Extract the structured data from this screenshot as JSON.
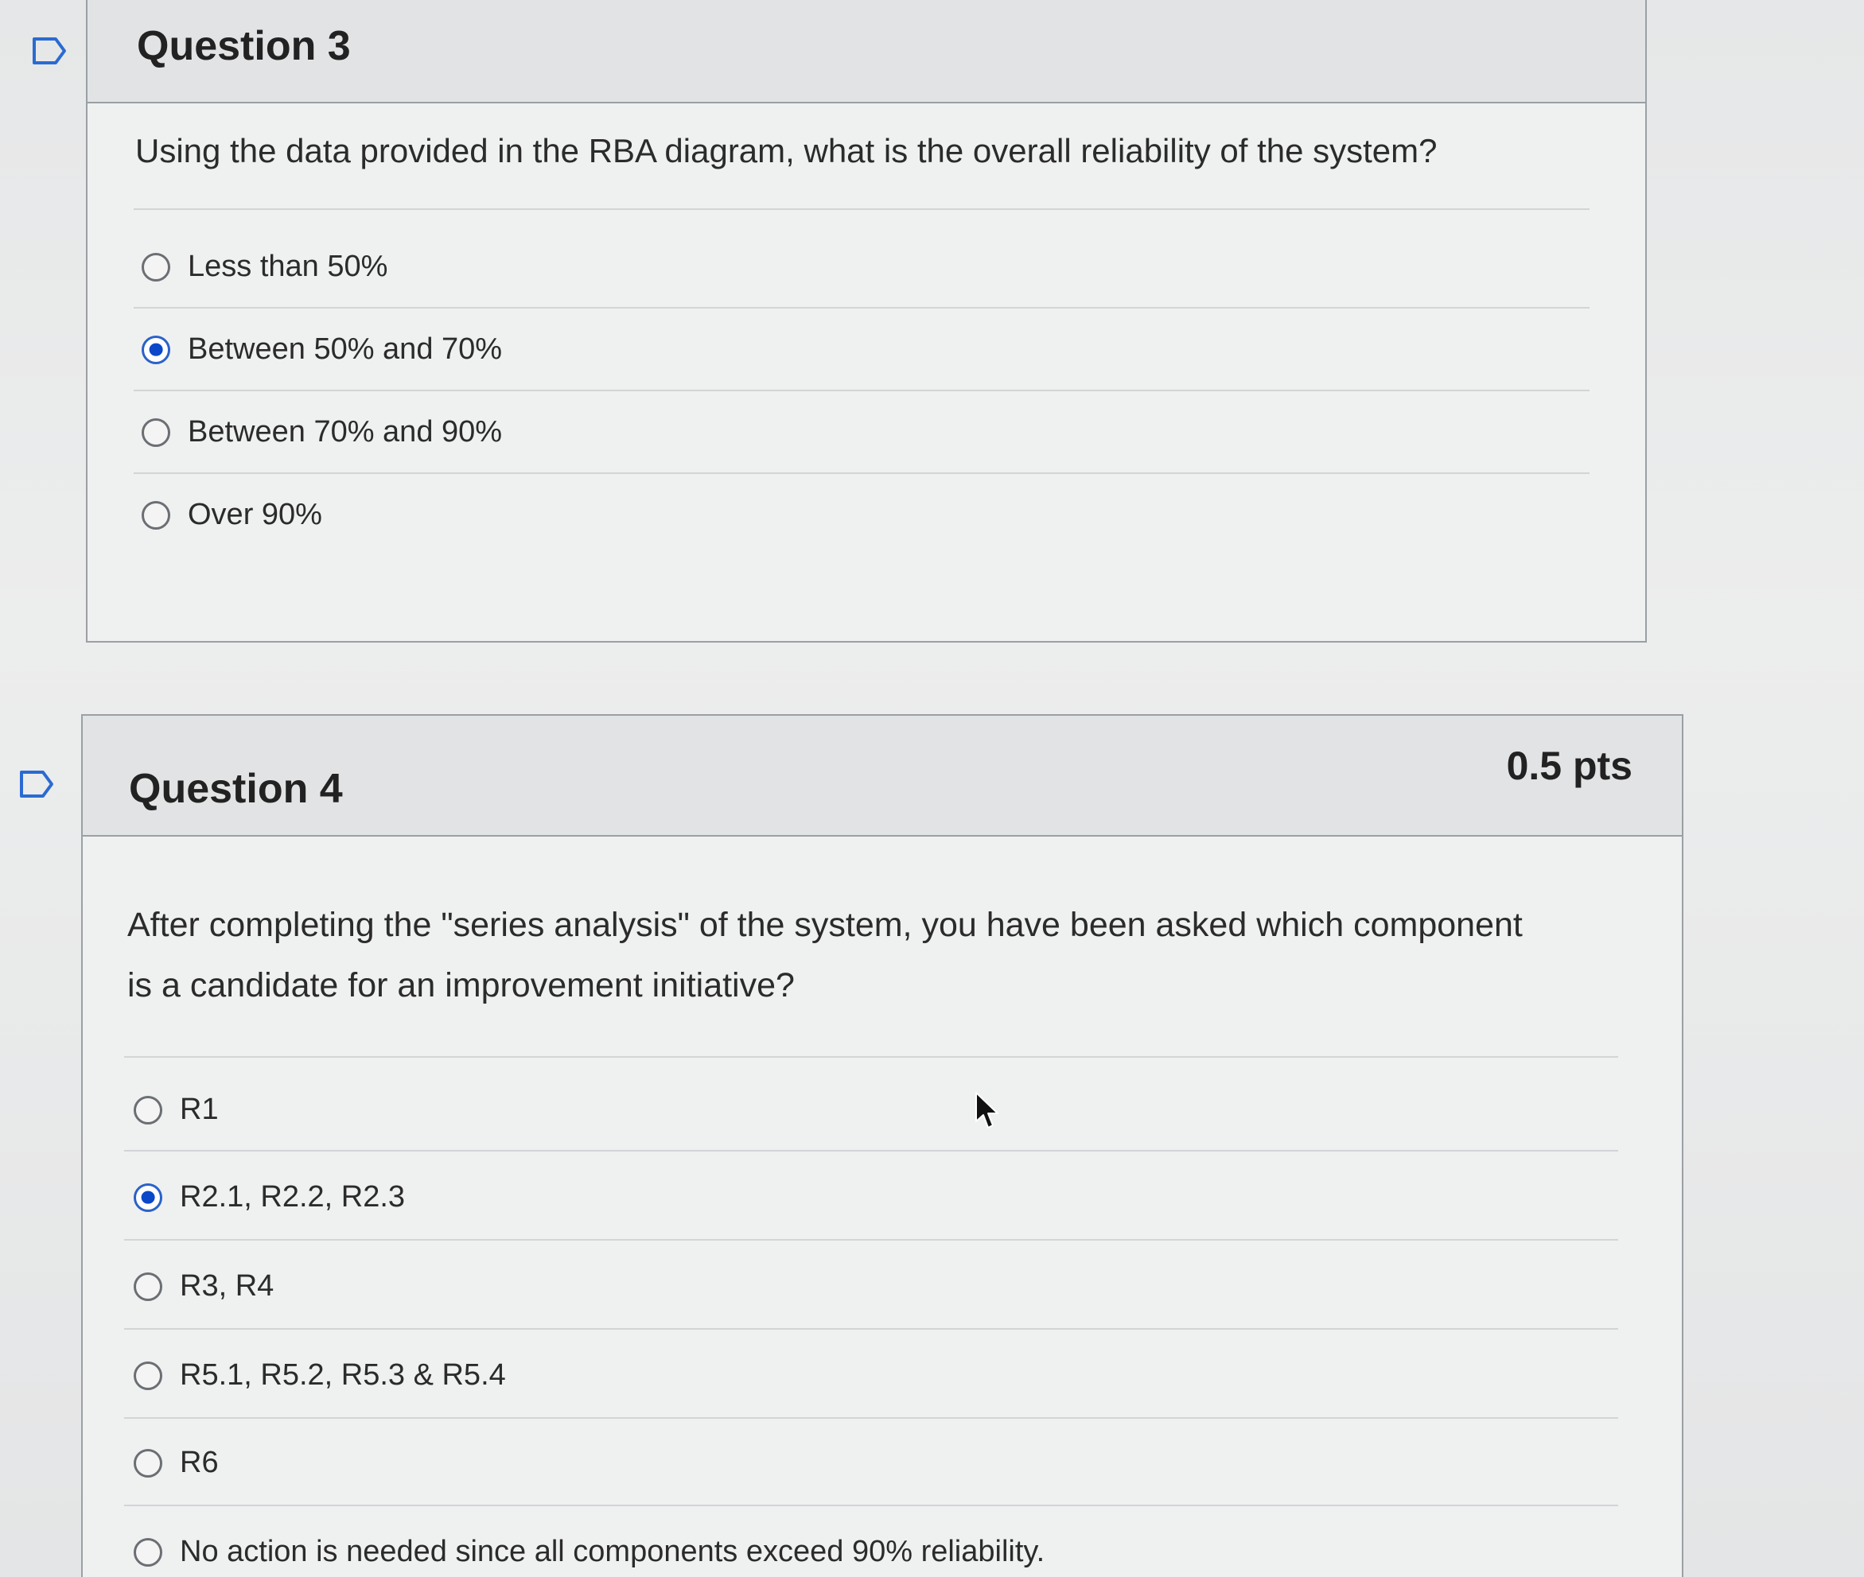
{
  "questions": [
    {
      "title": "Question 3",
      "points": "",
      "text": "Using the data provided in the RBA diagram, what is the overall reliability of the system?",
      "answers": [
        {
          "label": "Less than 50%",
          "selected": false
        },
        {
          "label": "Between 50% and 70%",
          "selected": true
        },
        {
          "label": "Between 70% and 90%",
          "selected": false
        },
        {
          "label": "Over 90%",
          "selected": false
        }
      ]
    },
    {
      "title": "Question 4",
      "points": "0.5 pts",
      "text_line1": "After completing the \"series analysis\" of the system, you have been asked which component",
      "text_line2": "is a candidate for an improvement initiative?",
      "answers": [
        {
          "label": "R1",
          "selected": false
        },
        {
          "label": "R2.1, R2.2, R2.3",
          "selected": true
        },
        {
          "label": "R3, R4",
          "selected": false
        },
        {
          "label": "R5.1, R5.2, R5.3 & R5.4",
          "selected": false
        },
        {
          "label": "R6",
          "selected": false
        },
        {
          "label": "No action is needed since all components exceed 90% reliability.",
          "selected": false
        }
      ]
    }
  ],
  "icons": {
    "flag": "flag-outline-icon",
    "cursor": "mouse-pointer-icon"
  },
  "colors": {
    "selected_radio": "#0b47c9",
    "border": "#9aa0a4",
    "flag": "#2a6bd1"
  }
}
